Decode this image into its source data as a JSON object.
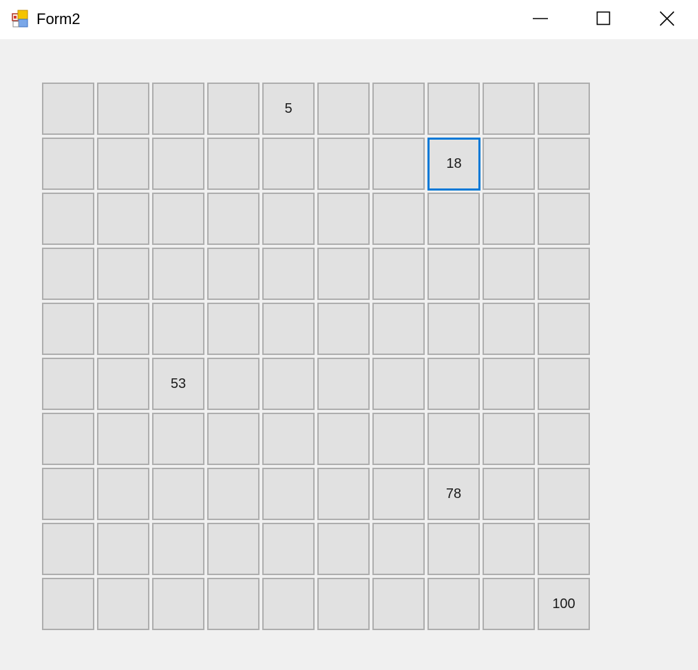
{
  "window": {
    "title": "Form2",
    "icon": "winforms-app-icon",
    "controls": [
      "minimize-icon",
      "maximize-icon",
      "close-icon"
    ]
  },
  "grid": {
    "rows": 10,
    "cols": 10,
    "focused_cell": 18,
    "labeled_cells": {
      "5": "5",
      "18": "18",
      "53": "53",
      "78": "78",
      "100": "100"
    }
  },
  "colors": {
    "focus_border": "#0078d7",
    "cell_fill": "#e1e1e1",
    "cell_border": "#adadad"
  }
}
